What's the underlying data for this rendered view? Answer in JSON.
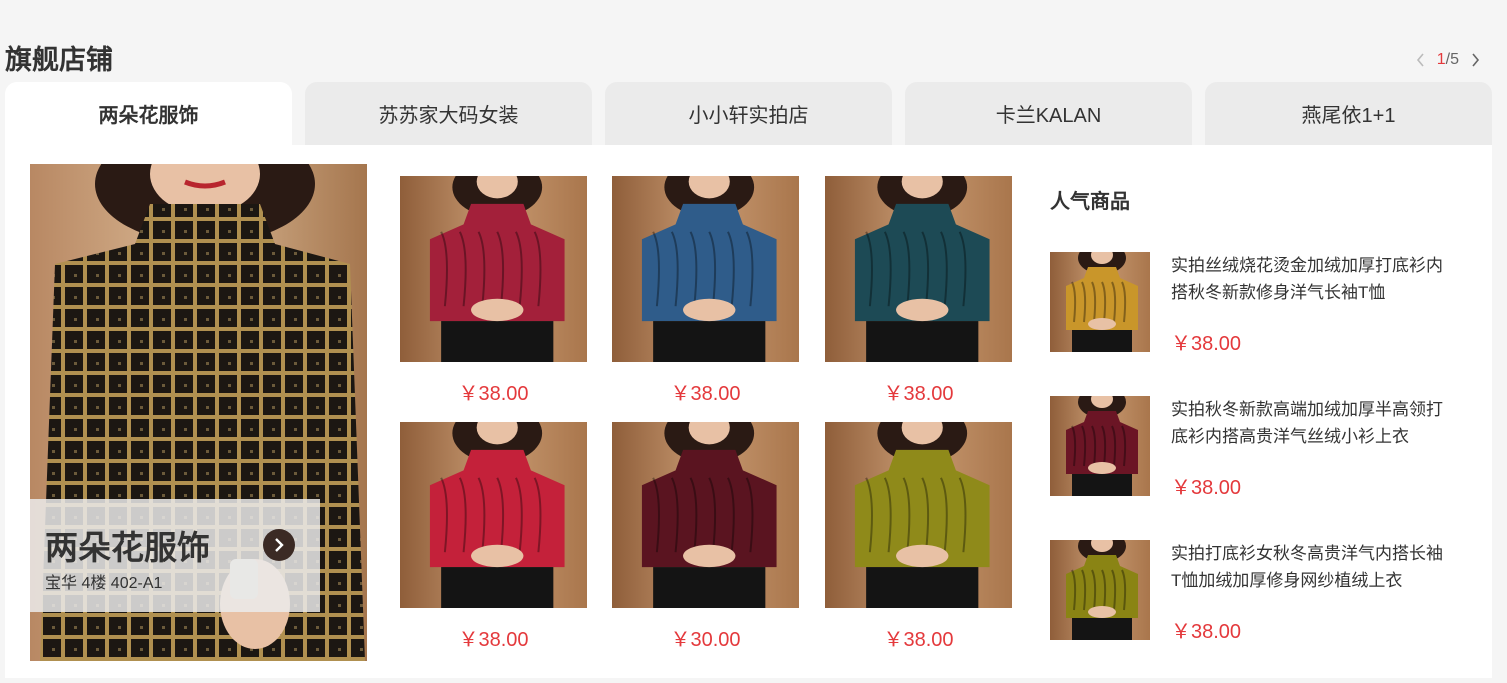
{
  "section": {
    "title": "旗舰店铺",
    "pager_current": "1",
    "pager_total": "/5"
  },
  "tabs": [
    {
      "label": "两朵花服饰",
      "active": true
    },
    {
      "label": "苏苏家大码女装",
      "active": false
    },
    {
      "label": "小小轩实拍店",
      "active": false
    },
    {
      "label": "卡兰KALAN",
      "active": false
    },
    {
      "label": "燕尾依1+1",
      "active": false
    }
  ],
  "hero": {
    "brand_name": "两朵花服饰",
    "address": "宝华 4楼 402-A1"
  },
  "grid": [
    {
      "price": "￥38.00",
      "color": "#a3203a"
    },
    {
      "price": "￥38.00",
      "color": "#2f5c8a"
    },
    {
      "price": "￥38.00",
      "color": "#1d4a55"
    },
    {
      "price": "￥38.00",
      "color": "#c4213a"
    },
    {
      "price": "￥30.00",
      "color": "#5a1420"
    },
    {
      "price": "￥38.00",
      "color": "#8f8a1a"
    }
  ],
  "popular": {
    "title": "人气商品",
    "items": [
      {
        "title": "实拍丝绒烧花烫金加绒加厚打底衫内搭秋冬新款修身洋气长袖T恤",
        "price": "￥38.00",
        "color": "#c9962a"
      },
      {
        "title": "实拍秋冬新款高端加绒加厚半高领打底衫内搭高贵洋气丝绒小衫上衣",
        "price": "￥38.00",
        "color": "#6b1525"
      },
      {
        "title": "实拍打底衫女秋冬高贵洋气内搭长袖T恤加绒加厚修身网纱植绒上衣",
        "price": "￥38.00",
        "color": "#8a8414"
      }
    ]
  },
  "colors": {
    "accent": "#e4393c",
    "tab_bg": "#ebebeb",
    "panel_bg": "#ffffff"
  }
}
